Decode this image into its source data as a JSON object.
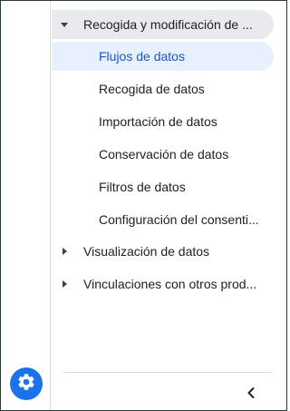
{
  "sidebar": {
    "sections": [
      {
        "label": "Recogida y modificación de ...",
        "expanded": true,
        "items": [
          {
            "label": "Flujos de datos",
            "active": true
          },
          {
            "label": "Recogida de datos",
            "active": false
          },
          {
            "label": "Importación de datos",
            "active": false
          },
          {
            "label": "Conservación de datos",
            "active": false
          },
          {
            "label": "Filtros de datos",
            "active": false
          },
          {
            "label": "Configuración del consenti...",
            "active": false
          }
        ]
      },
      {
        "label": "Visualización de datos",
        "expanded": false
      },
      {
        "label": "Vinculaciones con otros prod...",
        "expanded": false
      }
    ]
  },
  "icons": {
    "settings": "gear-icon",
    "collapse": "chevron-left-icon",
    "expanded_caret": "caret-down-icon",
    "collapsed_caret": "caret-right-icon"
  },
  "colors": {
    "accent": "#1a73e8",
    "active_bg": "#e8f0fe",
    "active_text": "#1a57c8",
    "expanded_bg": "#e8eaed"
  }
}
